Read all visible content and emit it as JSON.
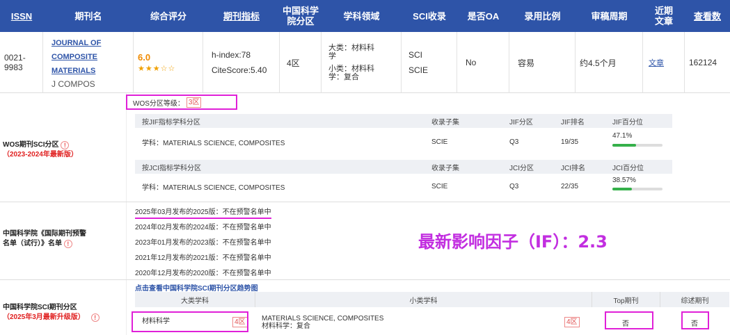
{
  "header": {
    "issn": "ISSN",
    "name": "期刊名",
    "score": "综合评分",
    "indicator": "期刊指标",
    "cas_zone_l1": "中国科学",
    "cas_zone_l2": "院分区",
    "field": "学科领域",
    "sci": "SCI收录",
    "oa": "是否OA",
    "accept": "录用比例",
    "review": "审稿周期",
    "recent_l1": "近期",
    "recent_l2": "文章",
    "views": "查看数"
  },
  "journal": {
    "issn_l1": "0021-",
    "issn_l2": "9983",
    "name_l1": "JOURNAL OF",
    "name_l2": "COMPOSITE",
    "name_l3": "MATERIALS",
    "abbr": "J COMPOS",
    "score": "6.0",
    "stars": "★★★☆☆",
    "h_index": "h-index:78",
    "citescore": "CiteScore:5.40",
    "cas_zone": "4区",
    "field_major_l1": "大类：材料科",
    "field_major_l2": "学",
    "field_minor_l1": "小类：材料科",
    "field_minor_l2": "学：复合",
    "sci_l1": "SCI",
    "sci_l2": "SCIE",
    "oa": "No",
    "accept": "容易",
    "review": "约4.5个月",
    "recent": "文章",
    "views": "162124"
  },
  "wos": {
    "label": "WOS期刊SCI分区",
    "edition": "（2023-2024年最新版）",
    "grade_label": "WOS分区等级：",
    "grade_value": "3区",
    "jif_table": {
      "h_subject": "按JIF指标学科分区",
      "h_set": "收录子集",
      "h_zone": "JIF分区",
      "h_rank": "JIF排名",
      "h_pct": "JIF百分位",
      "subject": "学科：MATERIALS SCIENCE, COMPOSITES",
      "set": "SCIE",
      "zone": "Q3",
      "rank": "19/35",
      "pct": "47.1%",
      "pct_value": 47.1
    },
    "jci_table": {
      "h_subject": "按JCI指标学科分区",
      "h_set": "收录子集",
      "h_zone": "JCI分区",
      "h_rank": "JCI排名",
      "h_pct": "JCI百分位",
      "subject": "学科：MATERIALS SCIENCE, COMPOSITES",
      "set": "SCIE",
      "zone": "Q3",
      "rank": "22/35",
      "pct": "38.57%",
      "pct_value": 38.57
    }
  },
  "warning": {
    "label_l1": "中国科学院《国际期刊预警",
    "label_l2": "名单（试行）》名单",
    "items": [
      "2025年03月发布的2025版：不在预警名单中",
      "2024年02月发布的2024版：不在预警名单中",
      "2023年01月发布的2023版：不在预警名单中",
      "2021年12月发布的2021版：不在预警名单中",
      "2020年12月发布的2020版：不在预警名单中"
    ],
    "latest_if": "最新影响因子（IF）：2.3"
  },
  "cas_section": {
    "label": "中国科学院SCI期刊分区",
    "edition": "（2025年3月最新升级版）",
    "trend_link": "点击查看中国科学院SCI期刊分区趋势图",
    "h_major": "大类学科",
    "h_minor": "小类学科",
    "h_top": "Top期刊",
    "h_review": "综述期刊",
    "major": "材料科学",
    "major_zone": "4区",
    "minor_en": "MATERIALS SCIENCE, COMPOSITES",
    "minor_cn": "材料科学：复合",
    "minor_zone": "4区",
    "top": "否",
    "review": "否"
  },
  "info_icon": "!",
  "colors": {
    "header_bg": "#2e54a8",
    "highlight": "#e020d8",
    "if_text": "#c22ee0",
    "star": "#f0a000"
  }
}
